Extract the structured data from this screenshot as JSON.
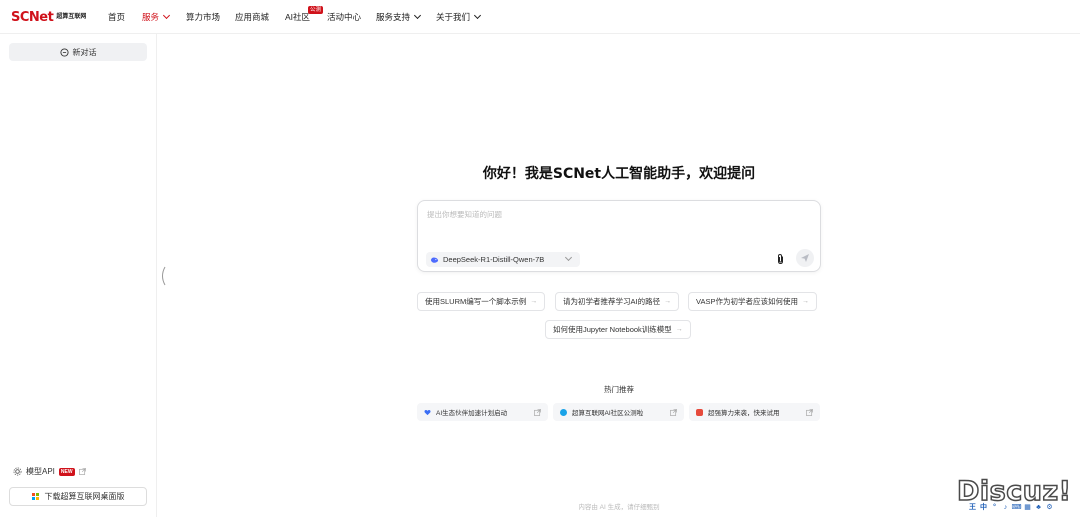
{
  "nav": {
    "logo_main": "SCNet",
    "logo_cn": "超算互联网",
    "items": [
      {
        "label": "首页",
        "dropdown": false,
        "active": false
      },
      {
        "label": "服务",
        "dropdown": true,
        "active": true
      },
      {
        "label": "算力市场",
        "dropdown": false,
        "active": false
      },
      {
        "label": "应用商城",
        "dropdown": false,
        "active": false
      },
      {
        "label": "AI社区",
        "dropdown": false,
        "active": false,
        "badge": "公测"
      },
      {
        "label": "活动中心",
        "dropdown": false,
        "active": false
      },
      {
        "label": "服务支持",
        "dropdown": true,
        "active": false
      },
      {
        "label": "关于我们",
        "dropdown": true,
        "active": false
      }
    ]
  },
  "sidebar": {
    "new_chat": "新对话",
    "model_api": "模型API",
    "new_badge": "NEW",
    "download": "下载超算互联网桌面版"
  },
  "main": {
    "welcome": "你好！我是SCNet人工智能助手，欢迎提问",
    "input_placeholder": "提出你想要知道的问题",
    "model": "DeepSeek-R1-Distill-Qwen-7B",
    "suggestions": [
      "使用SLURM编写一个脚本示例",
      "请为初学者推荐学习AI的路径",
      "VASP作为初学者应该如何使用",
      "如何使用Jupyter Notebook训练模型"
    ],
    "hot_title": "热门推荐",
    "hot_items": [
      "AI生态伙伴加速计划启动",
      "超算互联网AI社区公测啦",
      "超强算力来袭，快来试用"
    ],
    "footer": "内容由 AI 生成，请仔细甄别"
  },
  "watermark": {
    "text": "Discuz!",
    "tools": [
      "王",
      "中",
      "°",
      "♪",
      "⌨",
      "▦",
      "♣",
      "⚙"
    ]
  },
  "colors": {
    "brand": "#d0121b",
    "border": "#e3e4e7",
    "muted": "#f3f4f6"
  }
}
